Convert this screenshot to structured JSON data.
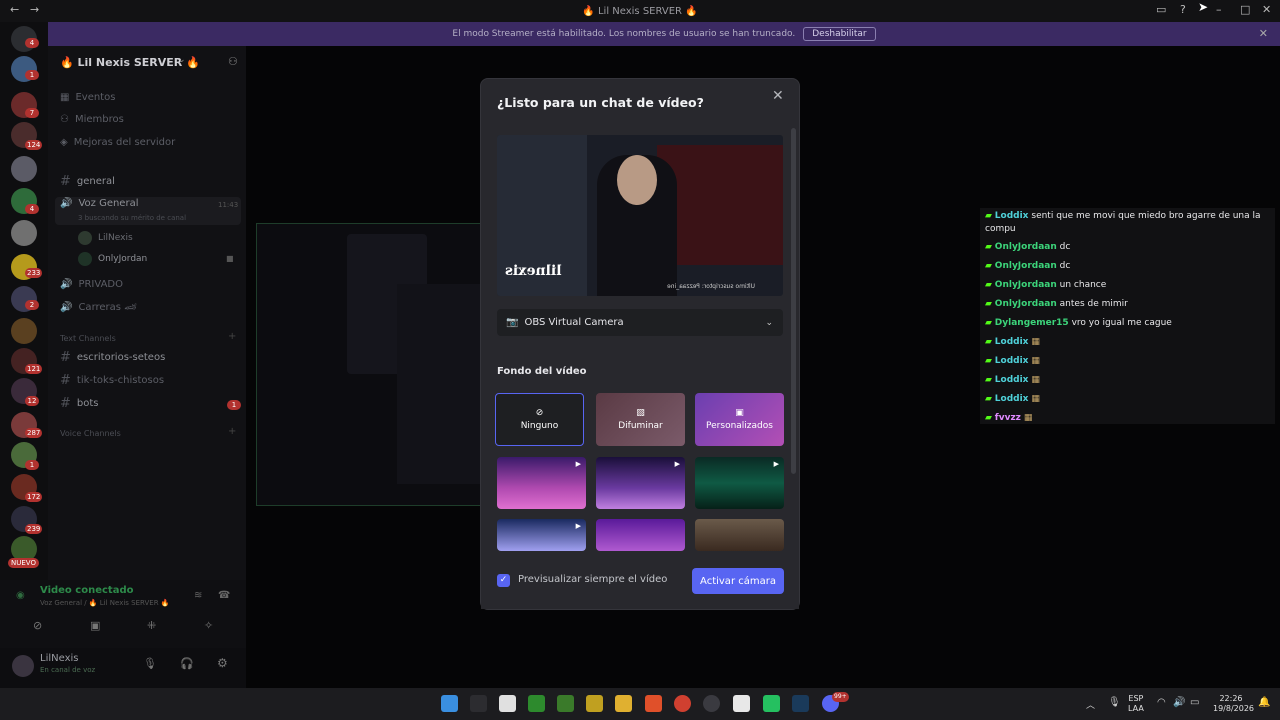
{
  "titlebar": {
    "title": "🔥 Lil Nexis SERVER 🔥"
  },
  "banner": {
    "text": "El modo Streamer está habilitado. Los nombres de usuario se han truncado.",
    "button": "Deshabilitar"
  },
  "server_list": {
    "badges": [
      "4",
      "1",
      "7",
      "124",
      "4",
      "233",
      "2",
      "121",
      "12",
      "287",
      "1",
      "172",
      "239"
    ],
    "new_label": "NUEVO"
  },
  "sidebar": {
    "server_name": "🔥 Lil Nexis SERVER 🔥",
    "items": [
      {
        "label": "Eventos"
      },
      {
        "label": "Miembros"
      },
      {
        "label": "Mejoras del servidor"
      }
    ],
    "channels": {
      "general": "general",
      "voice_general": "Voz General",
      "voice_time": "11:43",
      "voice_topic": "3 buscando su mérito de canal",
      "users": [
        "LilNexis",
        "OnlyJordan"
      ],
      "privado": "PRIVADO",
      "carreras": "Carreras 🏎",
      "text_cat": "Text Channels",
      "escritorios": "escritorios-seteos",
      "tiktoks": "tik-toks-chistosos",
      "bots": "bots",
      "bots_badge": "1",
      "voice_cat": "Voice Channels"
    }
  },
  "voice_panel": {
    "status": "Video conectado",
    "location": "Voz General / 🔥 Lil Nexis SERVER 🔥"
  },
  "user_panel": {
    "name": "LilNexis",
    "status": "En canal de voz"
  },
  "chat_overlay": [
    {
      "user": "Loddix",
      "msg": "senti que me movi que miedo bro agarre de una la compu",
      "color": "#4fd1d9"
    },
    {
      "user": "OnlyJordaan",
      "msg": "dc",
      "color": "#3cd47a"
    },
    {
      "user": "OnlyJordaan",
      "msg": "dc",
      "color": "#3cd47a"
    },
    {
      "user": "OnlyJordaan",
      "msg": "un chance",
      "color": "#3cd47a"
    },
    {
      "user": "OnlyJordaan",
      "msg": "antes de mimir",
      "color": "#3cd47a"
    },
    {
      "user": "Dylangemer15",
      "msg": "vro yo igual me cague",
      "color": "#3cd47a"
    },
    {
      "user": "Loddix",
      "msg": "",
      "color": "#4fd1d9"
    },
    {
      "user": "Loddix",
      "msg": "",
      "color": "#4fd1d9"
    },
    {
      "user": "Loddix",
      "msg": "",
      "color": "#4fd1d9"
    },
    {
      "user": "Loddix",
      "msg": "",
      "color": "#4fd1d9"
    },
    {
      "user": "fvvzz",
      "msg": "",
      "color": "#e08aff"
    }
  ],
  "modal": {
    "title": "¿Listo para un chat de vídeo?",
    "camera": "OBS Virtual Camera",
    "bg_section": "Fondo del vídeo",
    "bg_options": [
      "Ninguno",
      "Difuminar",
      "Personalizados"
    ],
    "always_preview": "Previsualizar siempre el vídeo",
    "activate": "Activar cámara",
    "preview_watermark": "lilnexis",
    "preview_caption": "Último suscriptor: Pezzaa_ine"
  },
  "taskbar": {
    "lang": "ESP",
    "lang2": "LAA",
    "time": "22:26",
    "date": "19/8/2026",
    "discord_badge": "99+"
  },
  "colors": {
    "accent": "#5865f2",
    "banner": "#3b2a63",
    "badge": "#b2322f"
  }
}
